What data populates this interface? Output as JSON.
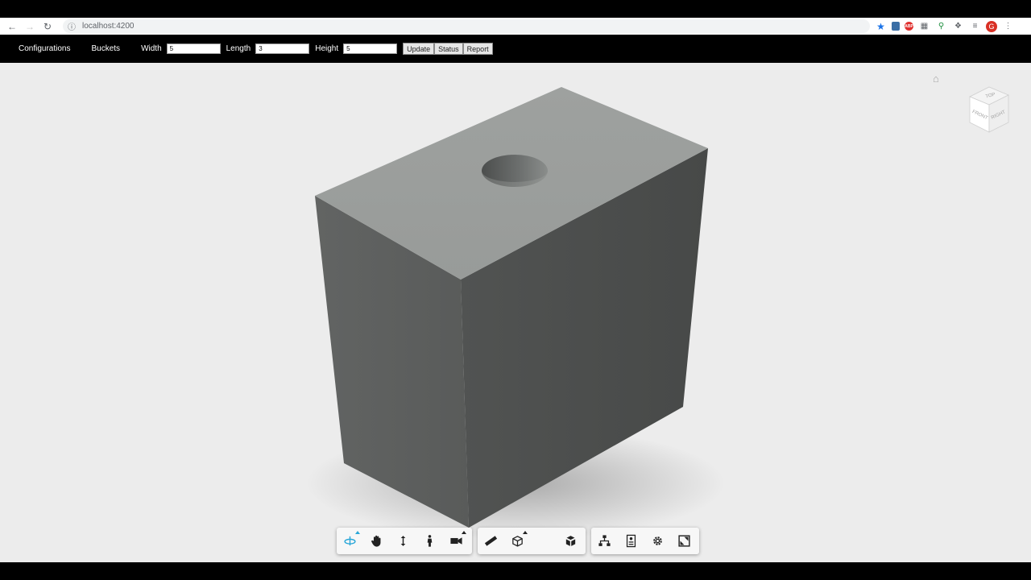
{
  "browser": {
    "url": "localhost:4200",
    "profile_initial": "G",
    "abp_label": "ABP"
  },
  "app_nav": {
    "configurations_label": "Configurations",
    "buckets_label": "Buckets",
    "width_label": "Width",
    "width_value": "5",
    "length_label": "Length",
    "length_value": "3",
    "height_label": "Height",
    "height_value": "5",
    "update_label": "Update",
    "status_label": "Status",
    "report_label": "Report"
  },
  "viewer": {
    "background_color": "#ececec",
    "viewcube_faces": {
      "top": "TOP",
      "front": "FRONT",
      "right": "RIGHT"
    }
  },
  "toolbar": {
    "groups": [
      [
        "orbit-icon",
        "pan-icon",
        "dolly-icon",
        "first-person-icon",
        "camera-icon"
      ],
      [
        "measure-icon",
        "section-icon",
        "explode-icon"
      ],
      [
        "model-browser-icon",
        "properties-icon",
        "settings-icon",
        "fullscreen-icon"
      ]
    ],
    "active_color": "#2aa7d8"
  },
  "colors": {
    "box_top": "#9c9f9d",
    "box_left": "#5f6160",
    "box_right": "#4a4c4b"
  }
}
